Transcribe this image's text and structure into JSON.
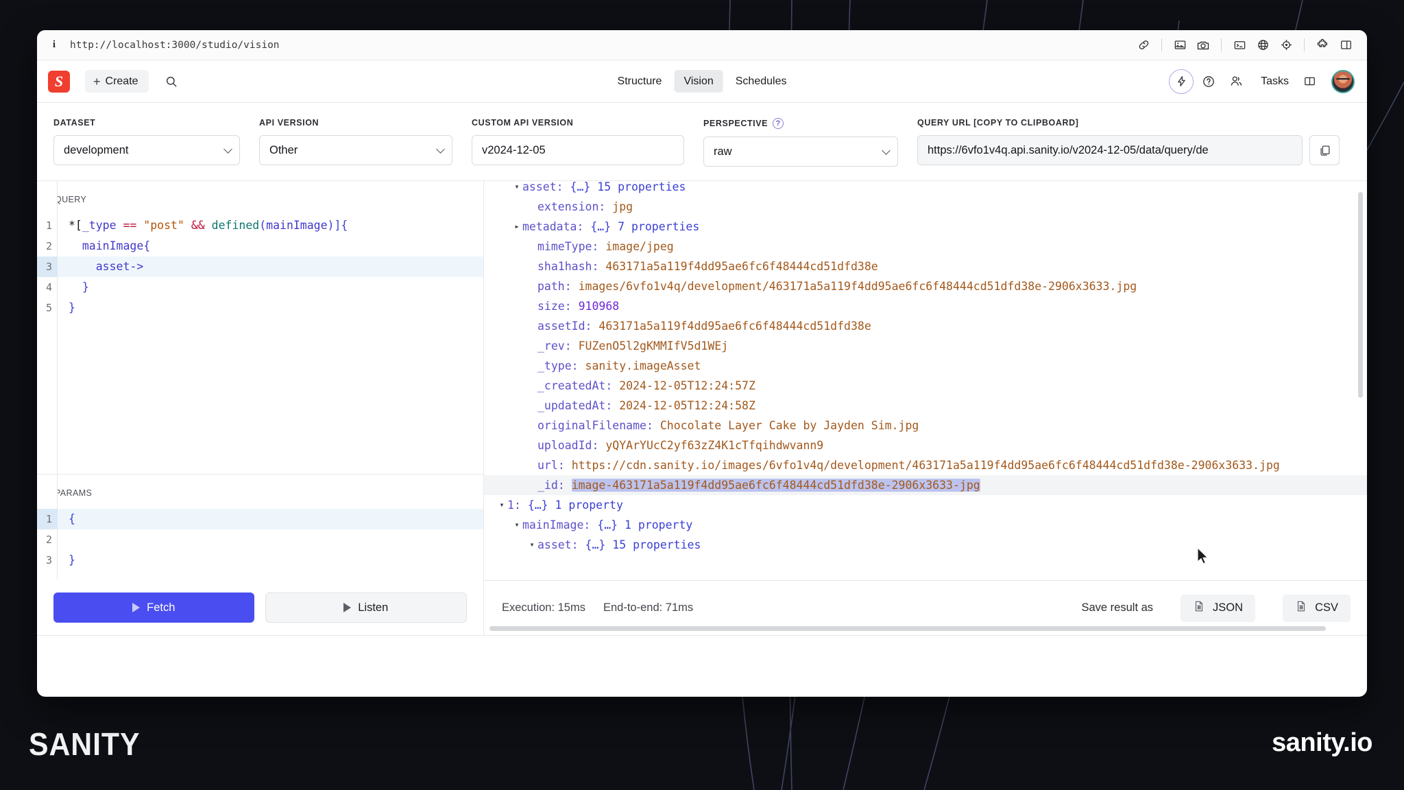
{
  "browser": {
    "url": "http://localhost:3000/studio/vision",
    "info_icon": "info-icon",
    "toolbar_icons": [
      "link-icon",
      "image-icon",
      "camera-icon",
      "terminal-icon",
      "globe-icon",
      "target-icon",
      "puzzle-extensions-icon",
      "sidebar-panel-icon"
    ]
  },
  "header": {
    "logo": "S",
    "create_label": "Create",
    "search_icon": "search-icon",
    "tabs": [
      {
        "label": "Structure",
        "active": false
      },
      {
        "label": "Vision",
        "active": true
      },
      {
        "label": "Schedules",
        "active": false
      }
    ],
    "icons": [
      "lightning-bolt-icon",
      "help-circle-icon",
      "members-icon"
    ],
    "tasks_label": "Tasks",
    "tasks_panel_icon": "panel-toggle-icon",
    "avatar": "user-avatar"
  },
  "controls": {
    "dataset": {
      "label": "DATASET",
      "value": "development"
    },
    "api_version": {
      "label": "API VERSION",
      "value": "Other"
    },
    "custom_api_version": {
      "label": "CUSTOM API VERSION",
      "value": "v2024-12-05"
    },
    "perspective": {
      "label": "PERSPECTIVE",
      "value": "raw",
      "help_glyph": "?"
    },
    "query_url": {
      "label": "QUERY URL [COPY TO CLIPBOARD]",
      "value": "https://6vfo1v4q.api.sanity.io/v2024-12-05/data/query/de",
      "copy_icon": "copy-icon"
    }
  },
  "query_editor": {
    "label": "QUERY",
    "lines": [
      {
        "n": "1",
        "active": false
      },
      {
        "n": "2",
        "active": false
      },
      {
        "n": "3",
        "active": true
      },
      {
        "n": "4",
        "active": false
      },
      {
        "n": "5",
        "active": false
      }
    ],
    "tokens": {
      "l1_star": "*[",
      "l1_type": "_type",
      "l1_eq": " == ",
      "l1_str": "\"post\"",
      "l1_and": " && ",
      "l1_fn": "defined",
      "l1_open": "(",
      "l1_arg": "mainImage",
      "l1_close": ")]{",
      "l2": "  mainImage{",
      "l3": "    asset->",
      "l4": "  }",
      "l5": "}"
    }
  },
  "params_editor": {
    "label": "PARAMS",
    "lines": [
      {
        "n": "1",
        "text": "{",
        "active": true
      },
      {
        "n": "2",
        "text": "",
        "active": false
      },
      {
        "n": "3",
        "text": "}",
        "active": false
      }
    ]
  },
  "actions": {
    "fetch_label": "Fetch",
    "listen_label": "Listen",
    "play_icon": "play-icon"
  },
  "result": {
    "rows": [
      {
        "indent": 1,
        "caret": "▾",
        "key": "asset",
        "sep": ": ",
        "meta": "{…} 15 properties",
        "clipped_top": true
      },
      {
        "indent": 2,
        "caret": "",
        "key": "extension",
        "sep": ": ",
        "str": "jpg"
      },
      {
        "indent": 1,
        "caret": "▸",
        "key": "metadata",
        "sep": ": ",
        "meta": "{…} 7 properties"
      },
      {
        "indent": 2,
        "caret": "",
        "key": "mimeType",
        "sep": ": ",
        "str": "image/jpeg"
      },
      {
        "indent": 2,
        "caret": "",
        "key": "sha1hash",
        "sep": ": ",
        "str": "463171a5a119f4dd95ae6fc6f48444cd51dfd38e"
      },
      {
        "indent": 2,
        "caret": "",
        "key": "path",
        "sep": ": ",
        "str": "images/6vfo1v4q/development/463171a5a119f4dd95ae6fc6f48444cd51dfd38e-2906x3633.jpg",
        "wrap": true
      },
      {
        "indent": 2,
        "caret": "",
        "key": "size",
        "sep": ": ",
        "num": "910968"
      },
      {
        "indent": 2,
        "caret": "",
        "key": "assetId",
        "sep": ": ",
        "str": "463171a5a119f4dd95ae6fc6f48444cd51dfd38e"
      },
      {
        "indent": 2,
        "caret": "",
        "key": "_rev",
        "sep": ": ",
        "str": "FUZenO5l2gKMMIfV5d1WEj"
      },
      {
        "indent": 2,
        "caret": "",
        "key": "_type",
        "sep": ": ",
        "str": "sanity.imageAsset"
      },
      {
        "indent": 2,
        "caret": "",
        "key": "_createdAt",
        "sep": ": ",
        "str": "2024-12-05T12:24:57Z"
      },
      {
        "indent": 2,
        "caret": "",
        "key": "_updatedAt",
        "sep": ": ",
        "str": "2024-12-05T12:24:58Z"
      },
      {
        "indent": 2,
        "caret": "",
        "key": "originalFilename",
        "sep": ": ",
        "str": "Chocolate Layer Cake by Jayden Sim.jpg"
      },
      {
        "indent": 2,
        "caret": "",
        "key": "uploadId",
        "sep": ": ",
        "str": "yQYArYUcC2yf63zZ4K1cTfqihdwvann9"
      },
      {
        "indent": 2,
        "caret": "",
        "key": "url",
        "sep": ": ",
        "str": "https://cdn.sanity.io/images/6vfo1v4q/development/463171a5a119f4dd95ae6fc6f48444cd51dfd38e-2906x3633.jpg",
        "wrap": true
      },
      {
        "indent": 2,
        "caret": "",
        "key": "_id",
        "sep": ": ",
        "str": "image-463171a5a119f4dd95ae6fc6f48444cd51dfd38e-2906x3633-jpg",
        "selected": true,
        "hover": true
      },
      {
        "indent": 0,
        "caret": "▾",
        "key": "1",
        "sep": ": ",
        "meta": "{…} 1 property"
      },
      {
        "indent": 1,
        "caret": "▾",
        "key": "mainImage",
        "sep": ": ",
        "meta": "{…} 1 property"
      },
      {
        "indent": 2,
        "caret": "▾",
        "key": "asset",
        "sep": ": ",
        "meta": "{…} 15 properties"
      }
    ]
  },
  "result_footer": {
    "execution": "Execution: 15ms",
    "end_to_end": "End-to-end: 71ms",
    "save_label": "Save result as",
    "json_label": "JSON",
    "csv_label": "CSV",
    "file_icon": "file-sheet-icon"
  },
  "branding": {
    "left": "SANITY",
    "right": "sanity.io"
  }
}
